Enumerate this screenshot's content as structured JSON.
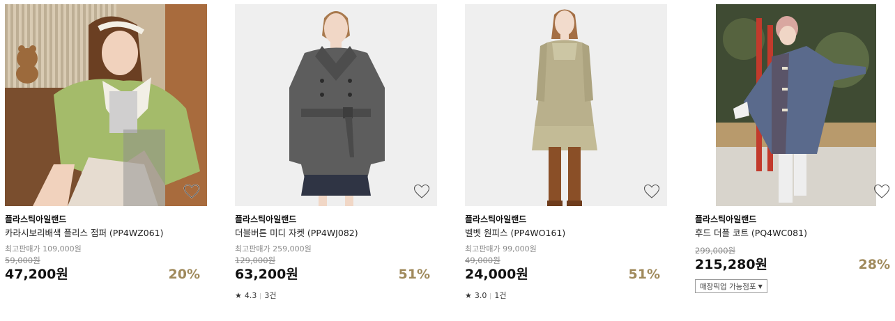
{
  "products": [
    {
      "brand": "플라스틱아일랜드",
      "name": "카라시보리배색 플리스 점퍼 (PP4WZ061)",
      "msrp_text": "최고판매가 109,000원",
      "original_price": "59,000원",
      "price": "47,200원",
      "discount": "20%",
      "rating": null,
      "reviews": null,
      "pickup": null
    },
    {
      "brand": "플라스틱아일랜드",
      "name": "더블버튼 미디 자켓 (PP4WJ082)",
      "msrp_text": "최고판매가 259,000원",
      "original_price": "129,000원",
      "price": "63,200원",
      "discount": "51%",
      "rating": "4.3",
      "reviews": "3건",
      "pickup": null
    },
    {
      "brand": "플라스틱아일랜드",
      "name": "벨벳 원피스 (PP4WO161)",
      "msrp_text": "최고판매가 99,000원",
      "original_price": "49,000원",
      "price": "24,000원",
      "discount": "51%",
      "rating": "3.0",
      "reviews": "1건",
      "pickup": null
    },
    {
      "brand": "플라스틱아일랜드",
      "name": "후드 더플 코트 (PQ4WC081)",
      "msrp_text": null,
      "original_price": "299,000원",
      "price": "215,280원",
      "discount": "28%",
      "rating": null,
      "reviews": null,
      "pickup": "매장픽업 가능점포"
    }
  ],
  "icons": {
    "wishlist": "heart-outline-icon",
    "star": "star-icon",
    "dropdown": "triangle-down-icon"
  },
  "colors": {
    "discount": "#a08a5c",
    "price": "#111111",
    "strike": "#8a8a8a"
  }
}
